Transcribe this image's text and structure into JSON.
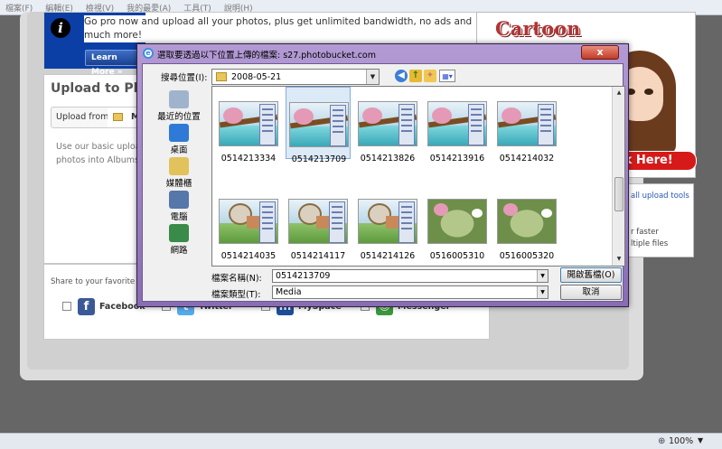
{
  "browser": {
    "menu": [
      "檔案(F)",
      "編輯(E)",
      "檢視(V)",
      "我的最愛(A)",
      "工具(T)",
      "說明(H)"
    ],
    "zoom": "100%"
  },
  "page": {
    "promo_text": "Go pro now and upload all your photos, plus get unlimited bandwidth, no ads and much more!",
    "learn_more": "Learn More »",
    "upload_title": "Upload to Photo",
    "upload_from_label": "Upload from:",
    "upload_from_value": "My",
    "upload_desc": "Use our basic upload photos into Albums.",
    "share_label": "Share to your favorite sites",
    "share_items": [
      {
        "name": "Facebook",
        "icon": "facebook-icon",
        "color": "#3b5998",
        "glyph": "f"
      },
      {
        "name": "Twitter",
        "icon": "twitter-icon",
        "color": "#55acee",
        "glyph": "t"
      },
      {
        "name": "MySpace",
        "icon": "myspace-icon",
        "color": "#1d4f9c",
        "glyph": "m"
      },
      {
        "name": "Messenger",
        "icon": "messenger-icon",
        "color": "#3a9a3a",
        "glyph": "☺"
      }
    ],
    "ad_cartoon": "Cartoon",
    "ad_click": "ck Here!",
    "side_link": "all upload tools",
    "side_text1": "r faster",
    "side_text2": "ltiple files"
  },
  "dialog": {
    "title": "選取要透過以下位置上傳的檔案: s27.photobucket.com",
    "lookin_label": "搜尋位置(I):",
    "lookin_value": "2008-05-21",
    "places": [
      {
        "label": "最近的位置",
        "icon": "recent-places-icon",
        "color": "#9fb4cc"
      },
      {
        "label": "桌面",
        "icon": "desktop-icon",
        "color": "#2f7ad6"
      },
      {
        "label": "媒體櫃",
        "icon": "libraries-icon",
        "color": "#e2c25a"
      },
      {
        "label": "電腦",
        "icon": "computer-icon",
        "color": "#5577aa"
      },
      {
        "label": "網路",
        "icon": "network-icon",
        "color": "#3a8a4a"
      }
    ],
    "files": [
      {
        "name": "0514213334",
        "scene": "bridge"
      },
      {
        "name": "0514213709",
        "scene": "bridge",
        "selected": true
      },
      {
        "name": "0514213826",
        "scene": "bridge"
      },
      {
        "name": "0514213916",
        "scene": "bridge"
      },
      {
        "name": "0514214032",
        "scene": "bridge"
      },
      {
        "name": "0514214035",
        "scene": "tree"
      },
      {
        "name": "0514214117",
        "scene": "tree"
      },
      {
        "name": "0514214126",
        "scene": "tree"
      },
      {
        "name": "0516005310",
        "scene": "board"
      },
      {
        "name": "0516005320",
        "scene": "board"
      }
    ],
    "filename_label": "檔案名稱(N):",
    "filename_value": "0514213709",
    "filetype_label": "檔案類型(T):",
    "filetype_value": "Media",
    "open_button": "開啟舊檔(O)",
    "cancel_button": "取消",
    "close_button": "x"
  }
}
